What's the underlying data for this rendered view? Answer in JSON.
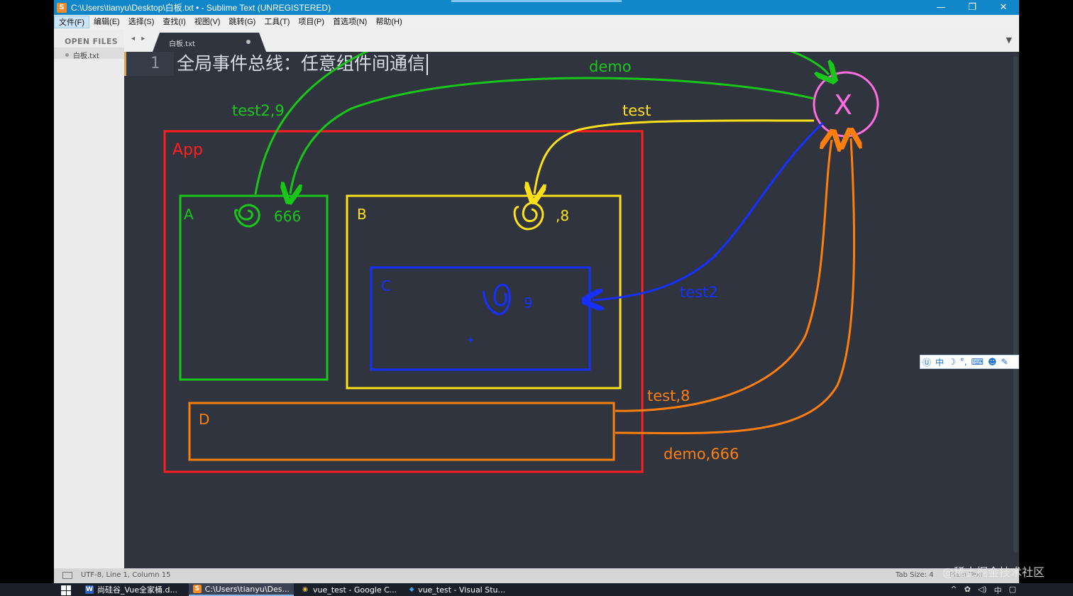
{
  "window": {
    "title": "C:\\Users\\tianyu\\Desktop\\白板.txt • - Sublime Text (UNREGISTERED)",
    "app_icon": "S",
    "minimize": "—",
    "restore": "❐",
    "close": "✕"
  },
  "menu": [
    "文件(F)",
    "编辑(E)",
    "选择(S)",
    "查找(I)",
    "视图(V)",
    "跳转(G)",
    "工具(T)",
    "项目(P)",
    "首选项(N)",
    "帮助(H)"
  ],
  "sidebar": {
    "header": "OPEN FILES",
    "files": [
      "白板.txt"
    ]
  },
  "tabs": {
    "nav": "◂ ▸",
    "active_tab": "白板.txt",
    "overflow": "▼"
  },
  "editor": {
    "line_number": "1",
    "line_text": "全局事件总线：任意组件间通信"
  },
  "diagram": {
    "labels": {
      "app": "App",
      "a": "A",
      "b": "B",
      "c": "C",
      "d": "D",
      "x": "X",
      "a_value": "666",
      "b_value": ",8",
      "c_value": "9",
      "demo": "demo",
      "test": "test",
      "test2_9": "test2,9",
      "test2": "test2",
      "test_8": "test,8",
      "demo_666": "demo,666"
    },
    "colors": {
      "app": "#ff1e1e",
      "a": "#19c719",
      "b": "#ffe11a",
      "c": "#1530ff",
      "d": "#ff7f0e",
      "x": "#ff6ee0"
    }
  },
  "status": {
    "position": "UTF-8, Line 1, Column 15",
    "tab_size": "Tab Size: 4",
    "syntax": "Plain Text"
  },
  "ime": {
    "logo": "Ⓤ",
    "mode": "中",
    "moon": "☽",
    "punct": "°,",
    "keyboard": "⌨",
    "user": "☻",
    "tool": "✎"
  },
  "taskbar": {
    "tasks": [
      {
        "icon": "W",
        "label": "尚硅谷_Vue全家桶.d..."
      },
      {
        "icon": "S",
        "label": "C:\\Users\\tianyu\\Des..."
      },
      {
        "icon": "◉",
        "label": "vue_test - Google C..."
      },
      {
        "icon": "◆",
        "label": "vue_test - Visual Stu..."
      }
    ],
    "tray": [
      "^",
      "✿",
      "◁)",
      "中",
      "▢"
    ]
  },
  "watermark": "@稀土掘金技术社区"
}
